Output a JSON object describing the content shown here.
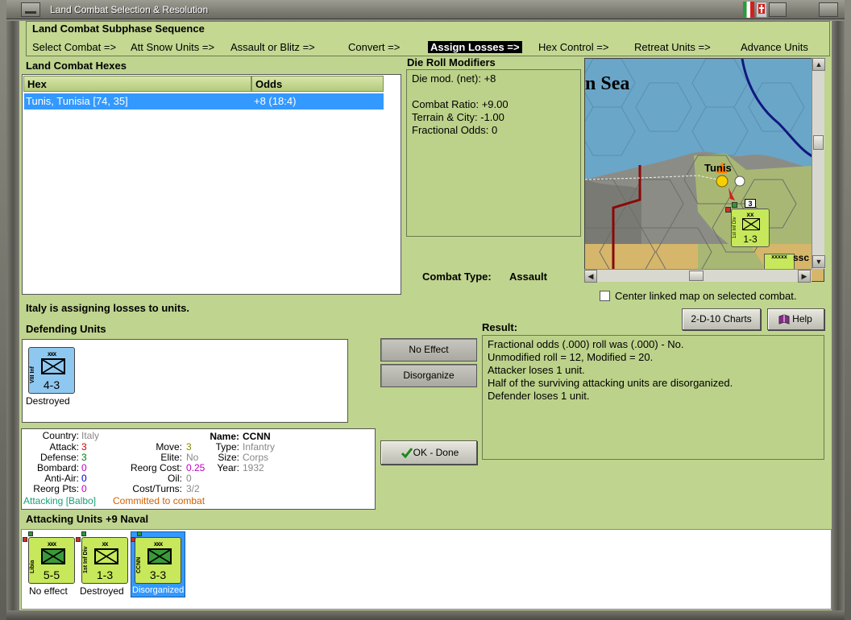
{
  "window": {
    "title": "Land Combat Selection & Resolution"
  },
  "sequence": {
    "title": "Land Combat Subphase Sequence",
    "steps": [
      {
        "label": "Select Combat =>"
      },
      {
        "label": "Att Snow Units =>"
      },
      {
        "label": "Assault or Blitz =>"
      },
      {
        "label": "Convert =>"
      },
      {
        "label": "Assign Losses =>"
      },
      {
        "label": "Hex Control =>"
      },
      {
        "label": "Retreat Units =>"
      },
      {
        "label": "Advance Units"
      }
    ],
    "active": "Assign Losses =>"
  },
  "hexes": {
    "heading": "Land Combat Hexes",
    "columns": [
      "Hex",
      "Odds"
    ],
    "rows": [
      {
        "hex": "Tunis, Tunisia [74, 35]",
        "odds": "+8 (18:4)"
      }
    ]
  },
  "modifiers": {
    "heading": "Die Roll Modifiers",
    "net": "Die mod. (net): +8",
    "combat_ratio": "Combat Ratio: +9.00",
    "terrain": "Terrain & City: -1.00",
    "fractional": "Fractional Odds: 0"
  },
  "combat_type": {
    "label": "Combat Type:",
    "value": "Assault"
  },
  "map": {
    "sea_label": "n Sea",
    "city_label": "Tunis",
    "unit_size": "xx",
    "unit_strength": "1-3",
    "unit_side_label": "1st Inf Div",
    "stack_count": "3",
    "stack_size": "xxxxx",
    "stack_extra": "ssc"
  },
  "center_map": {
    "label": "Center linked map on selected combat.",
    "checked": false
  },
  "status": {
    "message": "Italy is assigning losses to units."
  },
  "buttons": {
    "charts": "2-D-10 Charts",
    "help": "Help",
    "no_effect": "No Effect",
    "disorganize": "Disorganize",
    "ok_done": "OK - Done"
  },
  "defending": {
    "heading": "Defending Units",
    "units": [
      {
        "name": "VIII Inf",
        "size": "xxx",
        "strength": "4-3",
        "status": "Destroyed",
        "color": "#8ec8f0"
      }
    ]
  },
  "result": {
    "heading": "Result:",
    "lines": [
      "Fractional odds (.000) roll was (.000)  - No.",
      "Unmodified roll = 12, Modified = 20.",
      "Attacker loses 1 unit.",
      "Half of the surviving attacking units are disorganized.",
      "Defender loses 1 unit."
    ]
  },
  "unit_info": {
    "country_label": "Country:",
    "country": "Italy",
    "name_label": "Name:",
    "name": "CCNN",
    "attack_label": "Attack:",
    "attack": "3",
    "move_label": "Move:",
    "move": "3",
    "type_label": "Type:",
    "type": "Infantry",
    "defense_label": "Defense:",
    "defense": "3",
    "elite_label": "Elite:",
    "elite": "No",
    "size_label": "Size:",
    "size": "Corps",
    "bombard_label": "Bombard:",
    "bombard": "0",
    "reorg_cost_label": "Reorg Cost:",
    "reorg_cost": "0.25",
    "year_label": "Year:",
    "year": "1932",
    "antiair_label": "Anti-Air:",
    "antiair": "0",
    "oil_label": "Oil:",
    "oil": "0",
    "reorg_pts_label": "Reorg Pts:",
    "reorg_pts": "0",
    "cost_turns_label": "Cost/Turns:",
    "cost_turns": "3/2",
    "attacking_note": "Attacking [Balbo]",
    "committed_note": "Committed to combat"
  },
  "attacking": {
    "heading": "Attacking Units +9 Naval",
    "units": [
      {
        "name": "Libia",
        "size": "xxx",
        "strength": "5-5",
        "status": "No effect",
        "color": "#c6e85a"
      },
      {
        "name": "1st Inf Div",
        "size": "xx",
        "strength": "1-3",
        "status": "Destroyed",
        "color": "#c6e85a"
      },
      {
        "name": "CCNN",
        "size": "xxx",
        "strength": "3-3",
        "status": "Disorganized",
        "color": "#c6e85a"
      }
    ]
  },
  "colors": {
    "panel_green": "#bfd48e",
    "selection_blue": "#3399ff",
    "italy_unit": "#c6e85a",
    "allied_unit": "#8ec8f0"
  }
}
